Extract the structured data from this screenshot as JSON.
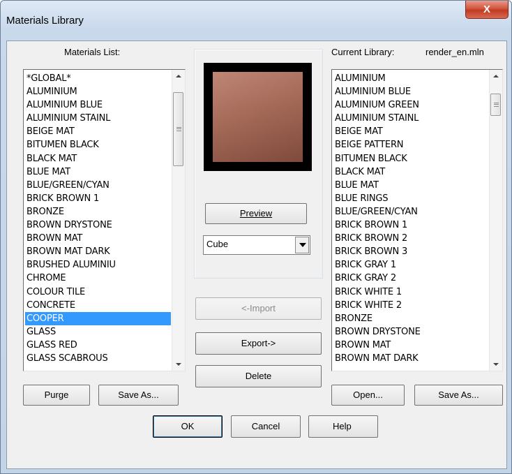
{
  "window": {
    "title": "Materials Library",
    "close_glyph": "X"
  },
  "materials_list": {
    "label": "Materials List:",
    "items": [
      "*GLOBAL*",
      "ALUMINIUM",
      "ALUMINIUM BLUE",
      "ALUMINIUM STAINL",
      "BEIGE MAT",
      "BITUMEN BLACK",
      "BLACK MAT",
      "BLUE MAT",
      "BLUE/GREEN/CYAN",
      "BRICK BROWN 1",
      "BRONZE",
      "BROWN DRYSTONE",
      "BROWN MAT",
      "BROWN MAT DARK",
      "BRUSHED ALUMINIU",
      "CHROME",
      "COLOUR TILE",
      "CONCRETE",
      "COOPER",
      "GLASS",
      "GLASS RED",
      "GLASS SCABROUS"
    ],
    "selected": "COOPER"
  },
  "current_library": {
    "label": "Current Library:",
    "file": "render_en.mln",
    "items": [
      "ALUMINIUM",
      "ALUMINIUM BLUE",
      "ALUMINIUM GREEN",
      "ALUMINIUM STAINL",
      "BEIGE MAT",
      "BEIGE PATTERN",
      "BITUMEN BLACK",
      "BLACK MAT",
      "BLUE MAT",
      "BLUE RINGS",
      "BLUE/GREEN/CYAN",
      "BRICK BROWN 1",
      "BRICK BROWN 2",
      "BRICK BROWN 3",
      "BRICK GRAY 1",
      "BRICK GRAY 2",
      "BRICK WHITE 1",
      "BRICK WHITE 2",
      "BRONZE",
      "BROWN DRYSTONE",
      "BROWN MAT",
      "BROWN MAT DARK"
    ]
  },
  "preview": {
    "button_label": "Preview",
    "shape_select_value": "Cube",
    "swatch_color": "#a56a58"
  },
  "buttons": {
    "import": "<-Import",
    "export": "Export->",
    "delete": "Delete",
    "purge": "Purge",
    "save_as_left": "Save As...",
    "open": "Open...",
    "save_as_right": "Save As...",
    "ok": "OK",
    "cancel": "Cancel",
    "help": "Help"
  },
  "colors": {
    "selection": "#3399ff",
    "close_button": "#c13a22"
  }
}
